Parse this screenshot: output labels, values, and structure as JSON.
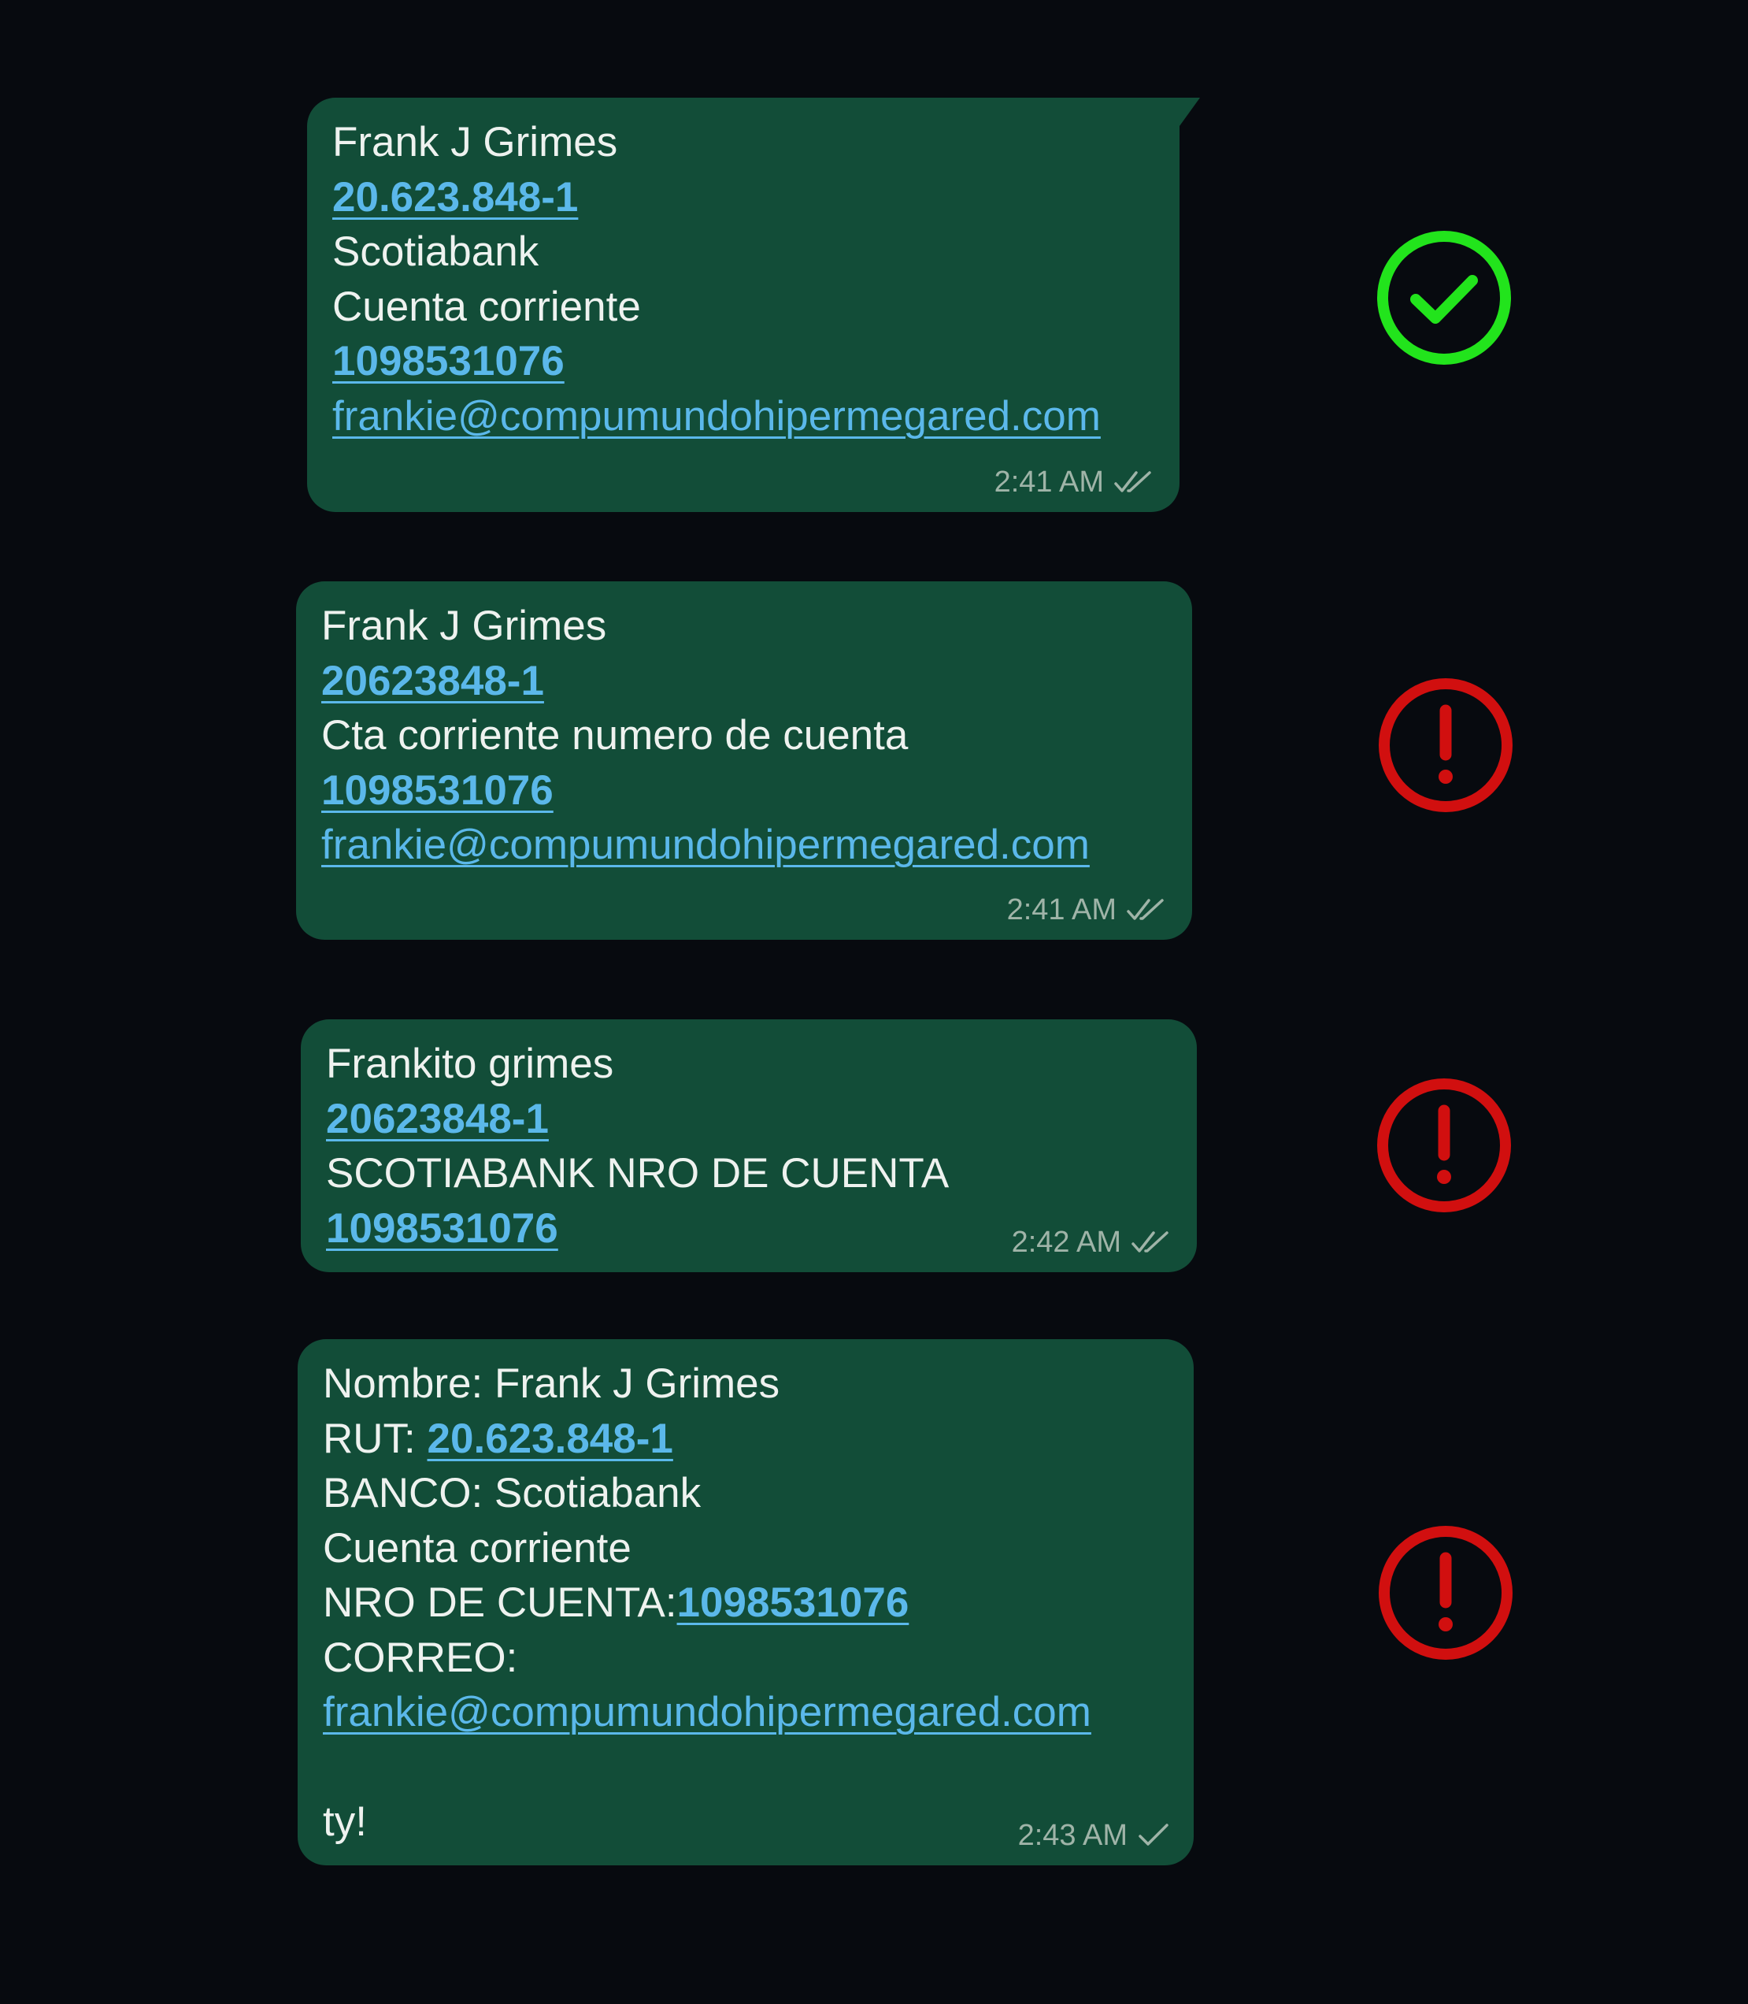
{
  "messages": [
    {
      "lines": [
        {
          "text": "Frank J Grimes"
        },
        {
          "link": "20.623.848-1"
        },
        {
          "text": "Scotiabank"
        },
        {
          "text": "Cuenta corriente"
        },
        {
          "link": "1098531076"
        },
        {
          "email": "frankie@compumundohipermegared.com"
        }
      ],
      "time": "2:41 AM",
      "receipt": "double-check-icon",
      "status": "valid"
    },
    {
      "lines": [
        {
          "text": "Frank J Grimes"
        },
        {
          "link": "20623848-1"
        },
        {
          "text": "Cta corriente numero de cuenta"
        },
        {
          "link": "1098531076"
        },
        {
          "email": "frankie@compumundohipermegared.com"
        }
      ],
      "time": "2:41 AM",
      "receipt": "double-check-icon",
      "status": "error"
    },
    {
      "lines": [
        {
          "text": "Frankito grimes"
        },
        {
          "link": "20623848-1"
        },
        {
          "text": "SCOTIABANK NRO DE CUENTA"
        },
        {
          "link": "1098531076"
        }
      ],
      "time": "2:42 AM",
      "receipt": "double-check-icon",
      "status": "error"
    },
    {
      "lines": [
        {
          "text": "Nombre: Frank J Grimes"
        },
        {
          "prefix": "RUT: ",
          "link": "20.623.848-1"
        },
        {
          "text": "BANCO: Scotiabank"
        },
        {
          "text": "Cuenta corriente"
        },
        {
          "prefix": "NRO DE CUENTA:",
          "link": "1098531076"
        },
        {
          "text": "CORREO:"
        },
        {
          "email": "frankie@compumundohipermegared.com"
        },
        {
          "text": ""
        },
        {
          "text": "ty!"
        }
      ],
      "time": "2:43 AM",
      "receipt": "single-check-icon",
      "status": "error"
    }
  ],
  "status_icons": {
    "valid": {
      "icon": "check-circle-icon",
      "color": "#22e41c"
    },
    "error": {
      "icon": "exclamation-circle-icon",
      "color": "#d10f0f"
    }
  },
  "colors": {
    "background": "#070a0f",
    "bubble": "#124d38",
    "text": "#eef2ef",
    "link": "#5bb8ea",
    "meta": "#9fb4a8"
  }
}
